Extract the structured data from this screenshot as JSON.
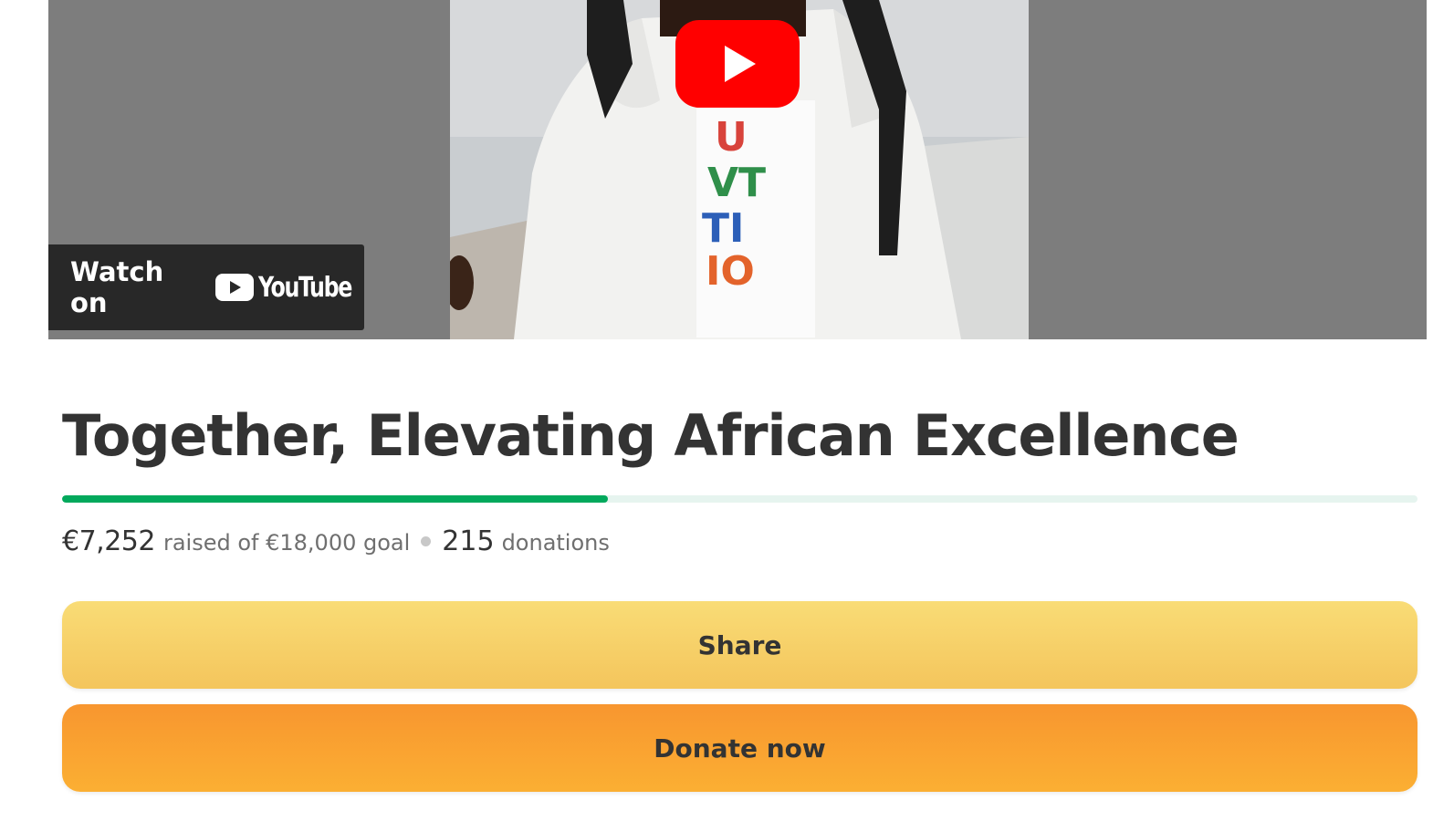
{
  "video": {
    "watch_on_label": "Watch on",
    "youtube_label": "YouTube"
  },
  "campaign": {
    "title": "Together, Elevating African Excellence",
    "raised": "€7,252",
    "raised_of_goal_text": "raised of €18,000 goal",
    "donation_count": "215",
    "donations_label": "donations",
    "progress_fraction": 0.403
  },
  "buttons": {
    "share_label": "Share",
    "donate_label": "Donate now"
  },
  "colors": {
    "progress_fill": "#02a95c",
    "progress_track": "#e6f4ef",
    "share_button": "#f7d36a",
    "donate_button": "#f9a131",
    "youtube_red": "#ff0000"
  },
  "icons": [
    "youtube-play-icon",
    "youtube-logo-icon"
  ]
}
